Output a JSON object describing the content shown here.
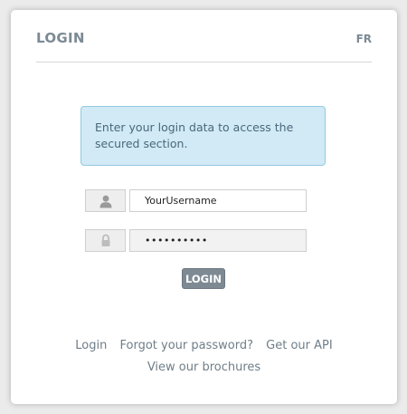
{
  "header": {
    "title": "LOGIN",
    "language_link": "FR"
  },
  "alert": {
    "message": "Enter your login data to access the secured section."
  },
  "form": {
    "username_value": "YourUsername",
    "password_value": "••••••••••",
    "submit_label": "LOGIN"
  },
  "footer_links": {
    "login": "Login",
    "forgot_password": "Forgot your password?",
    "get_api": "Get our API",
    "brochures": "View our brochures"
  },
  "icons": {
    "username": "user-icon",
    "password": "lock-icon"
  },
  "colors": {
    "header_text": "#7c8a94",
    "alert_background": "#d2eaf6",
    "alert_border": "#93c8e1",
    "button_background": "#7e8a93",
    "link_text": "#6f7e88"
  }
}
